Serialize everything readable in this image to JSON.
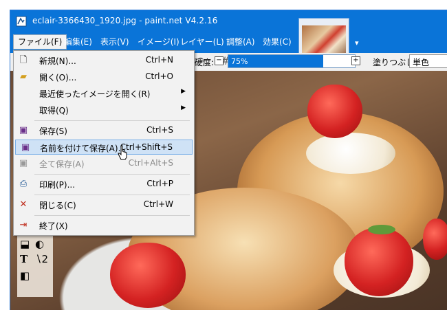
{
  "window": {
    "title": "eclair-3366430_1920.jpg - paint.net V4.2.16"
  },
  "menubar": {
    "items": [
      "ファイル(F)",
      "編集(E)",
      "表示(V)",
      "イメージ(I)",
      "レイヤー(L)",
      "調整(A)",
      "効果(C)"
    ]
  },
  "toolbar": {
    "hardness_label": "硬度:",
    "zoom_value": "75%",
    "zoom_fraction": 0.75,
    "fill_label": "塗りつぶし:",
    "fill_value": "単色"
  },
  "file_menu": {
    "items": [
      {
        "label": "新規(N)...",
        "shortcut": "Ctrl+N",
        "icon": "new-file-icon"
      },
      {
        "label": "開く(O)...",
        "shortcut": "Ctrl+O",
        "icon": "open-folder-icon"
      },
      {
        "label": "最近使ったイメージを開く(R)",
        "shortcut": "",
        "icon": ""
      },
      {
        "label": "取得(Q)",
        "shortcut": "",
        "icon": ""
      },
      {
        "label": "保存(S)",
        "shortcut": "Ctrl+S",
        "icon": "save-icon"
      },
      {
        "label": "名前を付けて保存(A)...",
        "shortcut": "Ctrl+Shift+S",
        "icon": "save-as-icon"
      },
      {
        "label": "全て保存(A)",
        "shortcut": "Ctrl+Alt+S",
        "icon": "save-all-icon"
      },
      {
        "label": "印刷(P)...",
        "shortcut": "Ctrl+P",
        "icon": "print-icon"
      },
      {
        "label": "閉じる(C)",
        "shortcut": "Ctrl+W",
        "icon": "close-file-icon"
      },
      {
        "label": "終了(X)",
        "shortcut": "",
        "icon": "exit-icon"
      }
    ]
  },
  "colors": {
    "accent": "#0a74d8",
    "menu_hover": "#cfe2f6"
  }
}
